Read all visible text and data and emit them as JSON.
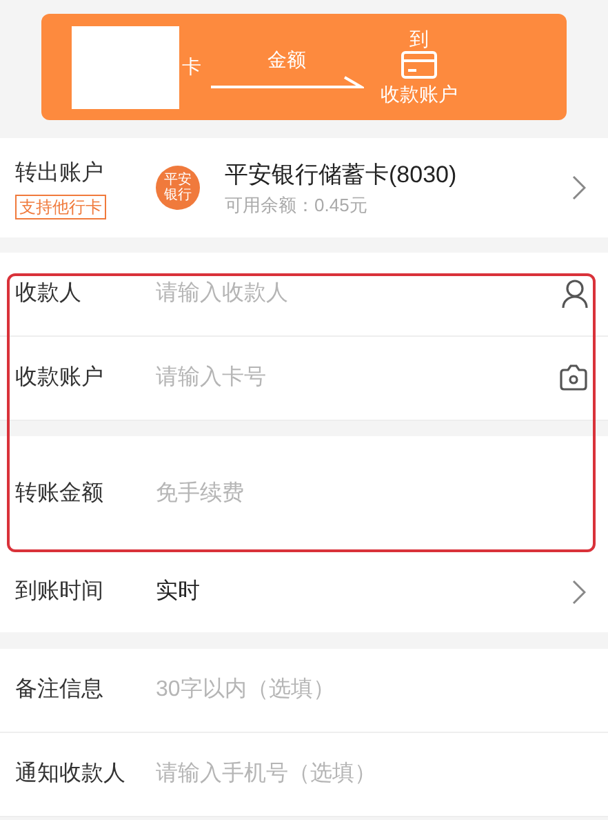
{
  "banner": {
    "from_label": "卡",
    "amount_label": "金额",
    "to_top": "到",
    "to_label": "收款账户"
  },
  "from_account": {
    "label": "转出账户",
    "tag": "支持他行卡",
    "bank_logo": [
      "平安",
      "银行"
    ],
    "bank_name": "平安银行储蓄卡(8030)",
    "balance": "可用余额：0.45元"
  },
  "highlighted_fields": [
    {
      "label": "收款人",
      "placeholder": "请输入收款人",
      "kind": "person"
    },
    {
      "label": "收款账户",
      "placeholder": "请输入卡号",
      "kind": "camera"
    },
    {
      "label": "转账金额",
      "placeholder": "免手续费",
      "kind": "plain"
    }
  ],
  "arrival": {
    "label": "到账时间",
    "value": "实时"
  },
  "extra_fields": [
    {
      "label": "备注信息",
      "placeholder": "30字以内（选填）"
    },
    {
      "label": "通知收款人",
      "placeholder": "请输入手机号（选填）"
    }
  ]
}
